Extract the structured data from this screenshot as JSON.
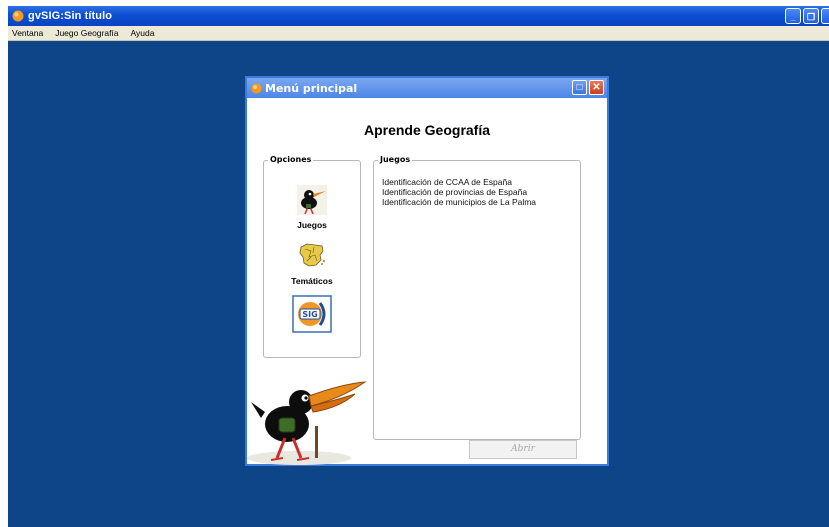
{
  "app": {
    "title": "gvSIG:Sin título",
    "menu": [
      "Ventana",
      "Juego Geografía",
      "Ayuda"
    ],
    "colors": {
      "title_bar": "#0c4ed2",
      "desktop": "#0e4588",
      "menu_bar": "#ece9d8"
    }
  },
  "dialog": {
    "title": "Menú principal",
    "heading": "Aprende Geografía",
    "options_legend": "Opciones",
    "options": [
      {
        "label": "Juegos",
        "icon": "bird-icon"
      },
      {
        "label": "Temáticos",
        "icon": "spain-map-icon"
      },
      {
        "label": "",
        "icon": "sig-logo-icon"
      }
    ],
    "games_legend": "Juegos",
    "games": [
      "Identificación de CCAA de España",
      "Identificación de provincias de España",
      "Identificación de municipios de La Palma"
    ],
    "open_button": "Abrir"
  }
}
